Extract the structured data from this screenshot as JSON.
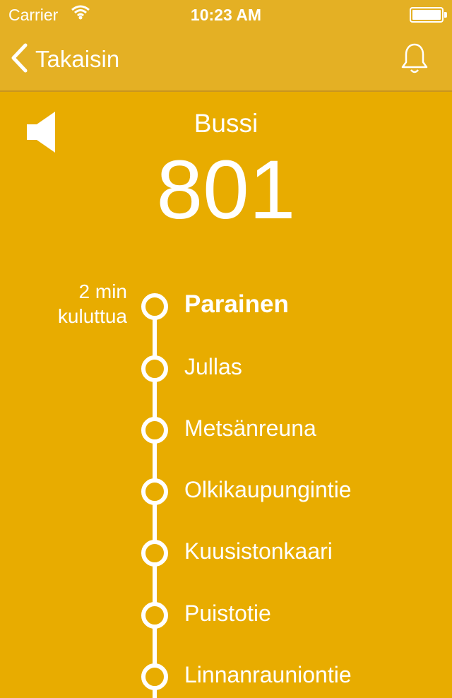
{
  "status_bar": {
    "carrier": "Carrier",
    "time": "10:23 AM"
  },
  "nav": {
    "back_label": "Takaisin"
  },
  "vehicle": {
    "type": "Bussi",
    "line": "801"
  },
  "eta": {
    "line1": "2 min",
    "line2": "kuluttua"
  },
  "stops": [
    "Parainen",
    "Jullas",
    "Metsänreuna",
    "Olkikaupungintie",
    "Kuusistonkaari",
    "Puistotie",
    "Linnanrauniontie"
  ],
  "colors": {
    "background": "#E8AC00",
    "bar": "#E4B024",
    "foreground": "#FFFFFF"
  },
  "icons": [
    "wifi-icon",
    "battery-icon",
    "back-chevron-icon",
    "bell-icon",
    "speaker-icon"
  ]
}
